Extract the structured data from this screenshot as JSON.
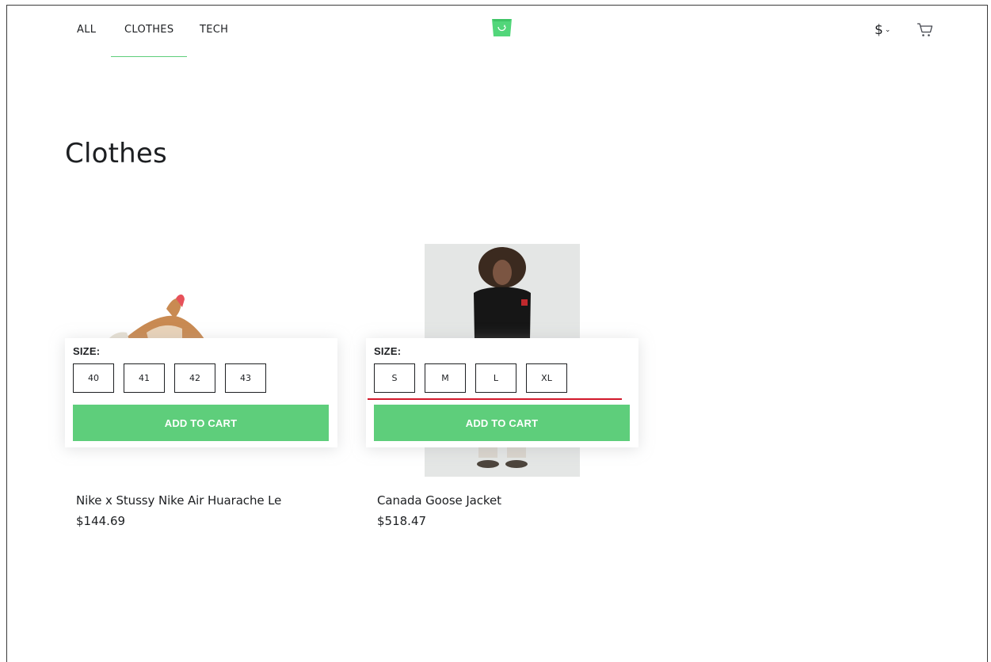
{
  "nav": {
    "items": [
      {
        "label": "ALL"
      },
      {
        "label": "CLOTHES",
        "active": true
      },
      {
        "label": "TECH"
      }
    ]
  },
  "header": {
    "logo_icon": "shopping-bag-logo-icon",
    "currency_symbol": "$",
    "currency_chevron": "⌄",
    "cart_icon": "cart-icon"
  },
  "category": {
    "title": "Clothes"
  },
  "products": [
    {
      "name": "Nike x Stussy Nike Air Huarache Le",
      "price": "$144.69",
      "size_label": "SIZE:",
      "sizes": [
        "40",
        "41",
        "42",
        "43"
      ],
      "add_to_cart": "ADD TO CART"
    },
    {
      "name": "Canada Goose Jacket",
      "price": "$518.47",
      "size_label": "SIZE:",
      "sizes": [
        "S",
        "M",
        "L",
        "XL"
      ],
      "add_to_cart": "ADD TO CART"
    }
  ],
  "colors": {
    "accent": "#5ece7b",
    "text": "#1d1f22",
    "annotation_line": "#d1172a"
  }
}
